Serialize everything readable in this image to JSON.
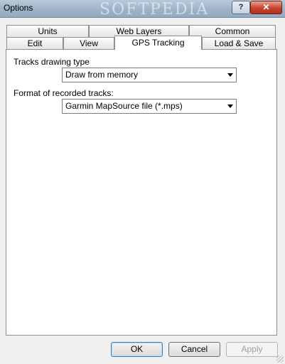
{
  "window": {
    "title": "Options",
    "watermark": "SOFTPEDIA"
  },
  "titlebar": {
    "help": "?",
    "close": "✕"
  },
  "tabs": {
    "row1": [
      "Units",
      "Web Layers",
      "Common"
    ],
    "row2": [
      "Edit",
      "View",
      "GPS Tracking",
      "Load & Save"
    ],
    "active": "GPS Tracking"
  },
  "gps": {
    "drawing_label": "Tracks drawing type",
    "drawing_value": "Draw from memory",
    "format_label": "Format of recorded tracks:",
    "format_value": "Garmin MapSource file (*.mps)"
  },
  "buttons": {
    "ok": "OK",
    "cancel": "Cancel",
    "apply": "Apply"
  }
}
